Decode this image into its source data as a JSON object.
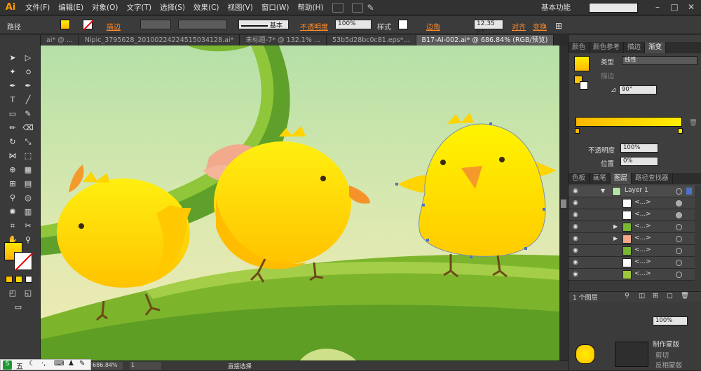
{
  "menubar": {
    "logo": "Ai",
    "items": [
      "文件(F)",
      "编辑(E)",
      "对象(O)",
      "文字(T)",
      "选择(S)",
      "效果(C)",
      "视图(V)",
      "窗口(W)",
      "帮助(H)"
    ],
    "workspace": "基本功能",
    "window_controls": [
      "–",
      "□",
      "✕"
    ]
  },
  "control_bar": {
    "label": "路径",
    "stroke_label": "描边",
    "stroke_style": "基本",
    "opacity_label": "不透明度",
    "opacity_value": "100%",
    "style_label": "样式",
    "corner_label": "边角",
    "corner_value": "12.35 px",
    "align_label": "对齐",
    "transform_label": "变换"
  },
  "doc_tabs": [
    {
      "label": "ai* @ ...",
      "active": false
    },
    {
      "label": "Nipic_3795628_20100224224515034128.ai*",
      "active": false
    },
    {
      "label": "未标题-7* @ 132.1% ...",
      "active": false
    },
    {
      "label": "53b5d28bc0c81.eps*...",
      "active": false
    },
    {
      "label": "B17-AI-002.ai* @ 686.84% (RGB/预览)",
      "active": true
    }
  ],
  "gradient_panel": {
    "tabs": [
      "颜色",
      "颜色参考",
      "描边",
      "渐变"
    ],
    "type_label": "类型",
    "type_value": "线性",
    "stroke_label": "描边",
    "angle_value": "90°",
    "opacity_label": "不透明度",
    "opacity_value": "100%",
    "location_label": "位置",
    "location_value": "0%",
    "gradient_start": "#ffb800",
    "gradient_end": "#ffee00"
  },
  "layers_panel": {
    "tabs": [
      "色板",
      "画笔",
      "图层",
      "路径查找器"
    ],
    "layer_name": "Layer 1",
    "rows": [
      {
        "name": "<...>",
        "thumb": "white",
        "expand": false
      },
      {
        "name": "<...>",
        "thumb": "white",
        "expand": false
      },
      {
        "name": "<...>",
        "thumb": "green",
        "expand": true
      },
      {
        "name": "<...>",
        "thumb": "pink",
        "expand": true
      },
      {
        "name": "<...>",
        "thumb": "green",
        "expand": false
      },
      {
        "name": "<...>",
        "thumb": "white",
        "expand": false
      },
      {
        "name": "<...>",
        "thumb": "leaf",
        "expand": false
      }
    ],
    "footer": "1 个图层"
  },
  "lower_panel": {
    "make_mask_label": "制作蒙版",
    "clip_label": "剪切",
    "invert_mask_label": "反相蒙版",
    "opacity_value": "100%"
  },
  "status_bar": {
    "zoom": "686.84%",
    "page": "1",
    "tool_label": "直接选择"
  },
  "colors": {
    "accent_orange": "#ff8a2a",
    "chick_yellow": "#ffd400",
    "sky_top": "#b4e0a8",
    "sky_bottom": "#f4ecb0",
    "leaf_green": "#7ab62e"
  },
  "taskbar": {
    "ime_text": "五"
  }
}
